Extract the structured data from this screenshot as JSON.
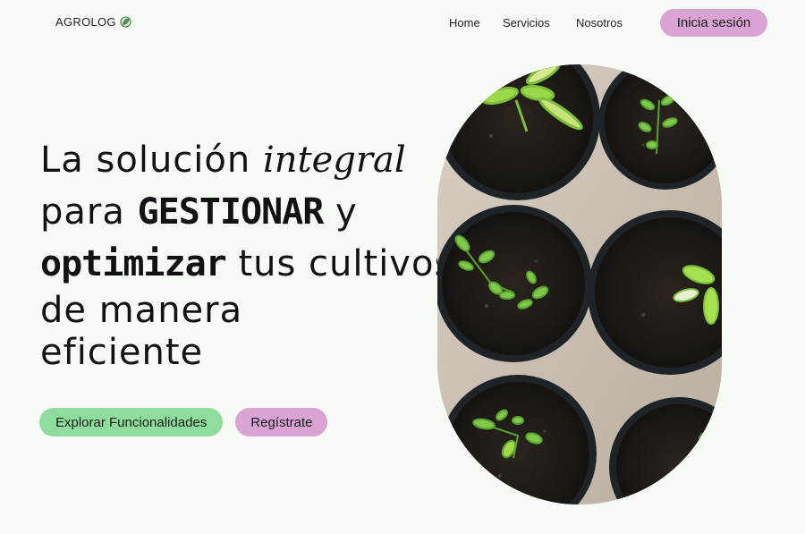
{
  "brand": {
    "name": "AGROLOG",
    "icon": "leaf-icon"
  },
  "nav": {
    "links": [
      "Home",
      "Servicios",
      "Nosotros"
    ],
    "login_label": "Inicia sesión"
  },
  "hero": {
    "title_parts": {
      "p1": "La solución ",
      "p2": "integral",
      "p3": "para ",
      "p4": "GESTIONAR",
      "p5": " y",
      "p6": "optimizar",
      "p7": " tus cultivos",
      "p8": "de manera",
      "p9": "eficiente"
    },
    "image_subject": "seedlings-in-pots-photo"
  },
  "cta": {
    "explore_label": "Explorar Funcionalidades",
    "register_label": "Regístrate"
  },
  "colors": {
    "background": "#f6fbf5",
    "accent_pink": "#d9a3d3",
    "accent_green": "#8fdc9f",
    "text": "#141414"
  }
}
